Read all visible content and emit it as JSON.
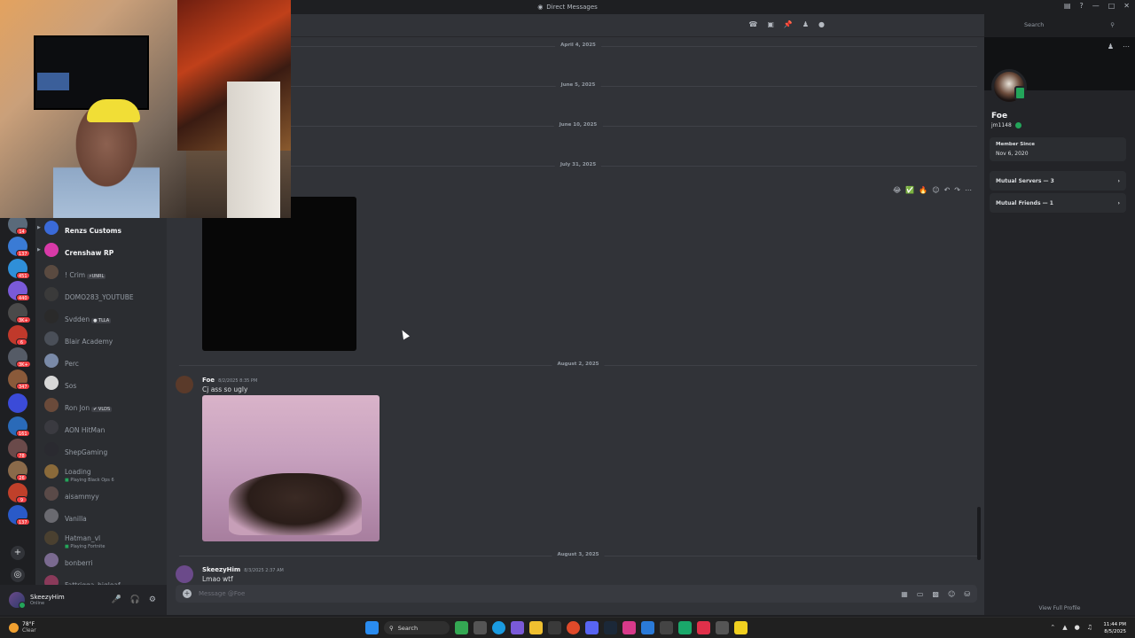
{
  "window": {
    "title": "Direct Messages",
    "controls": [
      "—",
      "□",
      "✕"
    ]
  },
  "servers": [
    {
      "color": "#5a6a7a",
      "badge": "14"
    },
    {
      "color": "#3a7bd5",
      "badge": "137"
    },
    {
      "color": "#2f8fd8",
      "badge": "451"
    },
    {
      "color": "#7a5ad8",
      "badge": "440"
    },
    {
      "color": "#4a4a4a",
      "badge": "3K+"
    },
    {
      "color": "#c0392b",
      "badge": "6"
    },
    {
      "color": "#555b66",
      "badge": "3K+"
    },
    {
      "color": "#8a5a3a",
      "badge": "347"
    },
    {
      "color": "#3b4bd8",
      "badge": ""
    },
    {
      "color": "#2a6ab8",
      "badge": "161"
    },
    {
      "color": "#6a4a4a",
      "badge": "78"
    },
    {
      "color": "#8a6a4a",
      "badge": "26"
    },
    {
      "color": "#c0402a",
      "badge": "9"
    },
    {
      "color": "#2a5ac8",
      "badge": "137"
    }
  ],
  "dm_list": [
    {
      "name": "Renzs Customs",
      "bright": true,
      "tag": "",
      "sub": "",
      "color": "#3a6ad8",
      "group": true
    },
    {
      "name": "Crenshaw RP",
      "bright": true,
      "tag": "",
      "sub": "",
      "color": "#d83aa8",
      "group": true
    },
    {
      "name": "! Crim",
      "bright": false,
      "tag": "⚡UNRL",
      "sub": "",
      "color": "#5a4a40"
    },
    {
      "name": "DOMO283_YOUTUBE",
      "bright": false,
      "tag": "",
      "sub": "",
      "color": "#3a3a3a"
    },
    {
      "name": "Svdden",
      "bright": false,
      "tag": "● TLLA",
      "sub": "",
      "color": "#2a2a2a"
    },
    {
      "name": "Blair Academy",
      "bright": false,
      "tag": "",
      "sub": "",
      "color": "#4a4f58"
    },
    {
      "name": "Perc",
      "bright": false,
      "tag": "",
      "sub": "",
      "color": "#7a8aa8"
    },
    {
      "name": "Sos",
      "bright": false,
      "tag": "",
      "sub": "",
      "color": "#d8d8d8"
    },
    {
      "name": "Ron Jon",
      "bright": false,
      "tag": "✔ VLDS",
      "sub": "",
      "color": "#6a4a3a"
    },
    {
      "name": "AON HitMan",
      "bright": false,
      "tag": "",
      "sub": "",
      "color": "#3a3a40"
    },
    {
      "name": "ShepGaming",
      "bright": false,
      "tag": "",
      "sub": "",
      "color": "#2a2a30"
    },
    {
      "name": "Loading",
      "bright": false,
      "tag": "",
      "sub": "Playing Black Ops 6",
      "color": "#8a6a3a"
    },
    {
      "name": "aisammyy",
      "bright": false,
      "tag": "",
      "sub": "",
      "color": "#5a4a48"
    },
    {
      "name": "Vanilla",
      "bright": false,
      "tag": "",
      "sub": "",
      "color": "#6a6a70"
    },
    {
      "name": "Hatman_vl",
      "bright": false,
      "tag": "",
      "sub": "Playing Fortnite",
      "color": "#4a4030"
    },
    {
      "name": "bonberri",
      "bright": false,
      "tag": "",
      "sub": "",
      "color": "#7a6a90"
    },
    {
      "name": "Fattrigga_bigloaf",
      "bright": false,
      "tag": "",
      "sub": "",
      "color": "#8a3a5a"
    }
  ],
  "user_panel": {
    "name": "SkeezyHim",
    "status": "Online"
  },
  "chat": {
    "dividers": [
      "April 4, 2025",
      "June 5, 2025",
      "June 10, 2025",
      "July 31, 2025",
      "August 2, 2025",
      "August 3, 2025"
    ],
    "messages": [
      {
        "author": "Foe",
        "time": "8/2/2025 8:35 PM",
        "text": "Cj ass so ugly",
        "avatar_color": "#5a3a2a"
      },
      {
        "author": "SkeezyHim",
        "time": "8/3/2025 2:37 AM",
        "text": "Lmao wtf",
        "avatar_color": "#6b4a8a"
      }
    ],
    "reactions": [
      "😂",
      "✅",
      "🔥"
    ],
    "composer_placeholder": "Message @Foe",
    "search_placeholder": "Search"
  },
  "profile": {
    "display_name": "Foe",
    "username": "jm1148",
    "member_since_label": "Member Since",
    "member_since": "Nov 6, 2020",
    "mutual_servers": "Mutual Servers — 3",
    "mutual_friends": "Mutual Friends — 1",
    "view_full": "View Full Profile"
  },
  "taskbar": {
    "temp": "78°F",
    "condition": "Clear",
    "search": "Search",
    "time": "11:44 PM",
    "date": "8/5/2025"
  }
}
